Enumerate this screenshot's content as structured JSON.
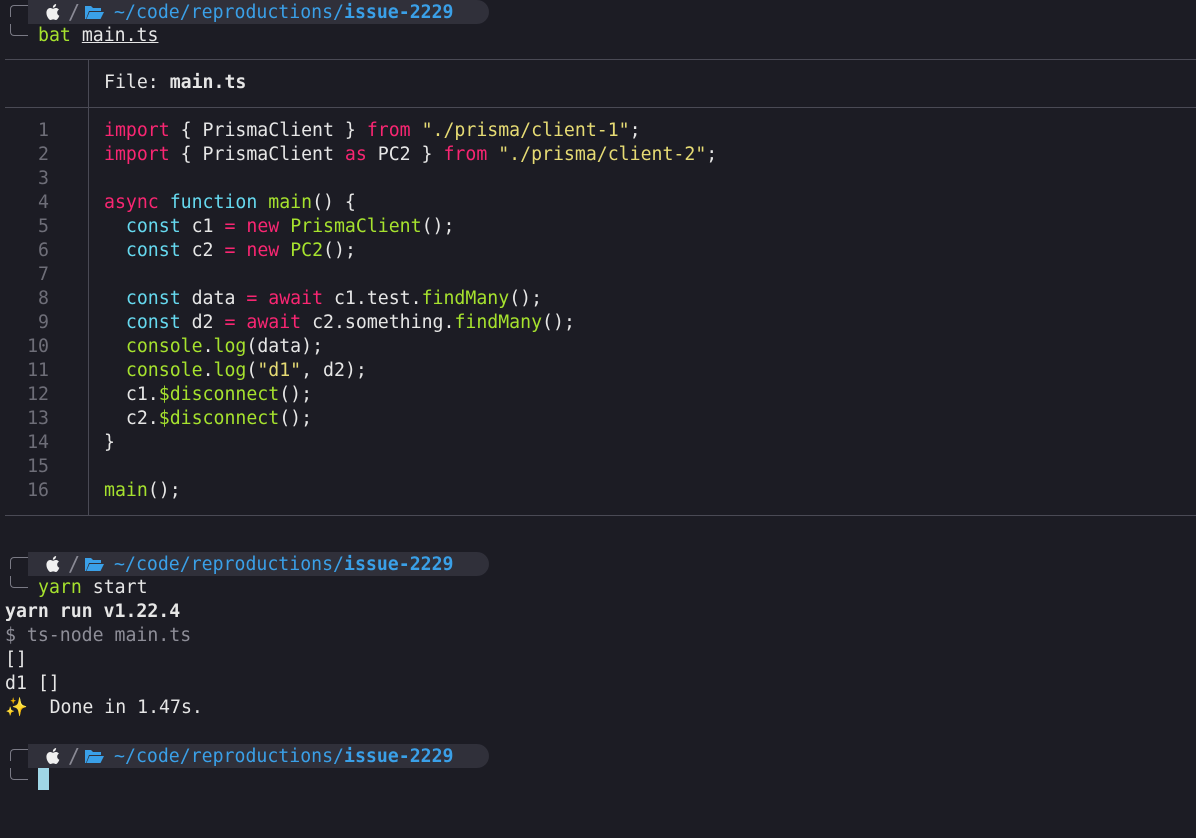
{
  "prompt": {
    "path_prefix": "~/code/reproductions/",
    "path_leaf": "issue-2229",
    "apple_icon": "apple-icon",
    "folder_icon": "folder-open-icon",
    "separator": "/"
  },
  "commands": [
    {
      "name": "bat",
      "arg": "main.ts"
    },
    {
      "name": "yarn",
      "arg": "start"
    }
  ],
  "bat": {
    "file_label": "File: ",
    "file_name": "main.ts",
    "lines": [
      {
        "n": "1",
        "text": "import { PrismaClient } from \"./prisma/client-1\";"
      },
      {
        "n": "2",
        "text": "import { PrismaClient as PC2 } from \"./prisma/client-2\";"
      },
      {
        "n": "3",
        "text": ""
      },
      {
        "n": "4",
        "text": "async function main() {"
      },
      {
        "n": "5",
        "text": "  const c1 = new PrismaClient();"
      },
      {
        "n": "6",
        "text": "  const c2 = new PC2();"
      },
      {
        "n": "7",
        "text": ""
      },
      {
        "n": "8",
        "text": "  const data = await c1.test.findMany();"
      },
      {
        "n": "9",
        "text": "  const d2 = await c2.something.findMany();"
      },
      {
        "n": "10",
        "text": "  console.log(data);"
      },
      {
        "n": "11",
        "text": "  console.log(\"d1\", d2);"
      },
      {
        "n": "12",
        "text": "  c1.$disconnect();"
      },
      {
        "n": "13",
        "text": "  c2.$disconnect();"
      },
      {
        "n": "14",
        "text": "}"
      },
      {
        "n": "15",
        "text": ""
      },
      {
        "n": "16",
        "text": "main();"
      }
    ]
  },
  "output": {
    "yarn_version": "yarn run v1.22.4",
    "ts_node": "$ ts-node main.ts",
    "result1": "[]",
    "result2": "d1 []",
    "sparkle": "✨",
    "done": "Done in 1.47s."
  },
  "colors": {
    "background": "#1c1c24",
    "path": "#3aa0e8",
    "keyword": "#f92672",
    "string": "#e6db74",
    "function": "#a6e22e",
    "type": "#66d9ef",
    "cursor": "#9fd6e6"
  }
}
